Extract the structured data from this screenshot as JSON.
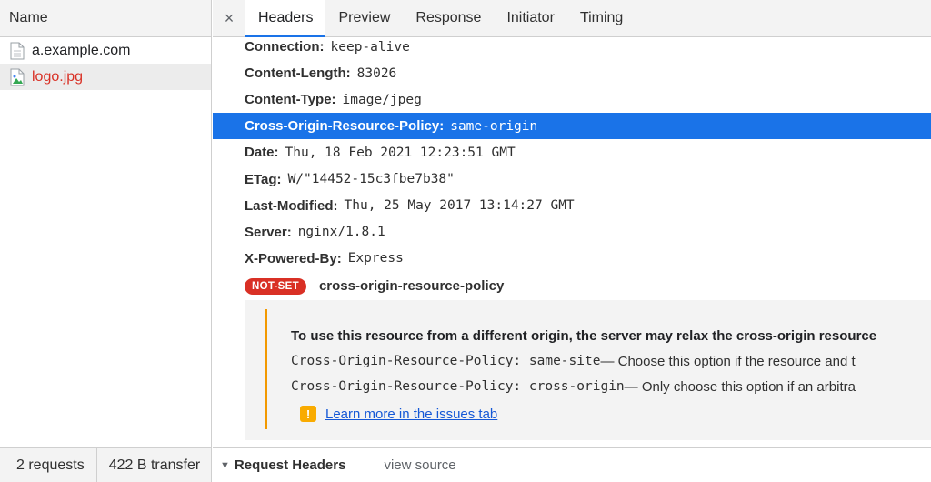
{
  "left_panel": {
    "header": "Name",
    "requests": [
      {
        "name": "a.example.com",
        "icon": "document-icon",
        "error": false
      },
      {
        "name": "logo.jpg",
        "icon": "image-file-icon",
        "error": true
      }
    ],
    "footer": {
      "requests": "2 requests",
      "transfer": "422 B transfer"
    }
  },
  "tabs": {
    "close": "×",
    "items": [
      "Headers",
      "Preview",
      "Response",
      "Initiator",
      "Timing"
    ],
    "active": "Headers"
  },
  "response_headers": [
    {
      "key": "Connection:",
      "value": "keep-alive"
    },
    {
      "key": "Content-Length:",
      "value": "83026"
    },
    {
      "key": "Content-Type:",
      "value": "image/jpeg"
    },
    {
      "key": "Cross-Origin-Resource-Policy:",
      "value": "same-origin",
      "selected": true
    },
    {
      "key": "Date:",
      "value": "Thu, 18 Feb 2021 12:23:51 GMT"
    },
    {
      "key": "ETag:",
      "value": "W/\"14452-15c3fbe7b38\""
    },
    {
      "key": "Last-Modified:",
      "value": "Thu, 25 May 2017 13:14:27 GMT"
    },
    {
      "key": "Server:",
      "value": "nginx/1.8.1"
    },
    {
      "key": "X-Powered-By:",
      "value": "Express"
    }
  ],
  "not_set": {
    "badge": "NOT-SET",
    "header_name": "cross-origin-resource-policy"
  },
  "issue": {
    "title": "To use this resource from a different origin, the server may relax the cross-origin resource",
    "option1_code": "Cross-Origin-Resource-Policy: same-site",
    "option1_text": " — Choose this option if the resource and t",
    "option2_code": "Cross-Origin-Resource-Policy: cross-origin",
    "option2_text": " — Only choose this option if an arbitra",
    "link": "Learn more in the issues tab"
  },
  "bottom": {
    "section": "Request Headers",
    "view_source": "view source"
  },
  "colors": {
    "accent": "#1a73e8",
    "error": "#d93025",
    "warning": "#f29900"
  }
}
